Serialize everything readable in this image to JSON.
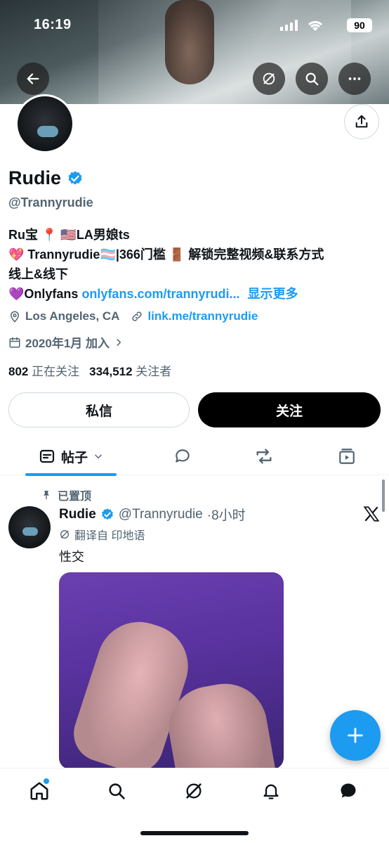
{
  "status_bar": {
    "time": "16:19",
    "battery": "90"
  },
  "profile": {
    "display_name": "Rudie",
    "handle": "@Trannyrudie",
    "bio_lines": [
      "Ru宝 📍 🇺🇸LA男娘ts",
      "💖 Trannyrudie🏳️‍⚧️|366门槛 🚪 解锁完整视频&联系方式",
      "线上&线下"
    ],
    "bio_link_prefix": "💜Onlyfans ",
    "bio_link": "onlyfans.com/trannyrudi...",
    "show_more": "显示更多",
    "location": "Los Angeles, CA",
    "website": "link.me/trannyrudie",
    "joined": "2020年1月 加入",
    "following_count": "802",
    "following_label": "正在关注",
    "followers_count": "334,512",
    "followers_label": "关注者"
  },
  "actions": {
    "dm_label": "私信",
    "follow_label": "关注"
  },
  "tabs": {
    "posts_label": "帖子"
  },
  "post": {
    "pinned_label": "已置顶",
    "name": "Rudie",
    "handle": "@Trannyrudie",
    "time": "·8小时",
    "translated_label": "翻译自 印地语",
    "text": "性交"
  },
  "colors": {
    "accent": "#1d9bf0",
    "text": "#0f1419",
    "muted": "#536471"
  }
}
